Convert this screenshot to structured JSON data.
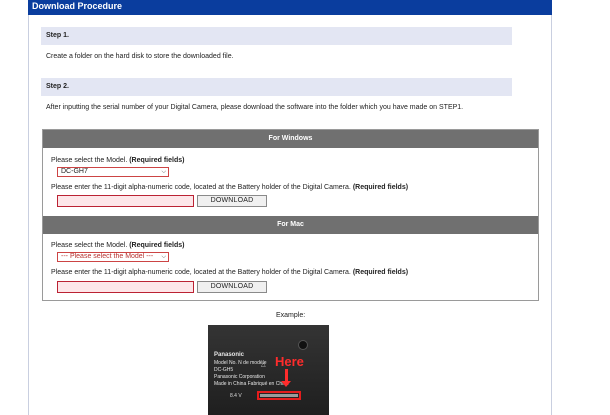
{
  "header": {
    "title": "Download Procedure"
  },
  "step1": {
    "label": "Step 1.",
    "text": "Create a folder on the hard disk to store the downloaded file."
  },
  "step2": {
    "label": "Step 2.",
    "text": "After inputting the serial number of your Digital Camera, please download the software into the folder which you have made on STEP1."
  },
  "windows": {
    "heading": "For Windows",
    "model_prompt": "Please select the Model.",
    "required": "(Required fields)",
    "model_value": "DC-GH7",
    "code_prompt": "Please enter the 11-digit alpha-numeric code, located at the Battery holder of the Digital Camera.",
    "code_required": "(Required fields)",
    "code_value": "",
    "download_label": "DOWNLOAD"
  },
  "mac": {
    "heading": "For Mac",
    "model_prompt": "Please select the Model.",
    "required": "(Required fields)",
    "model_value": "--- Please select the Model ---",
    "code_prompt": "Please enter the 11-digit alpha-numeric code, located at the Battery holder of the Digital Camera.",
    "code_required": "(Required fields)",
    "code_value": "",
    "download_label": "DOWNLOAD"
  },
  "example": {
    "label": "Example:",
    "brand": "Panasonic",
    "line2": "Model No. N de modèle",
    "line3": "DC-GH5",
    "line4": "Panasonic Corporation",
    "line5": "Made in China Fabriqué en Chine",
    "voltage": "8.4 V",
    "here": "Here"
  },
  "colors": {
    "header_bg": "#0a3d9e",
    "section_head_bg": "#707070",
    "step_bar_bg": "#e3e6f3",
    "input_bg": "#fde6e9",
    "accent_red": "#ff2c2c"
  }
}
